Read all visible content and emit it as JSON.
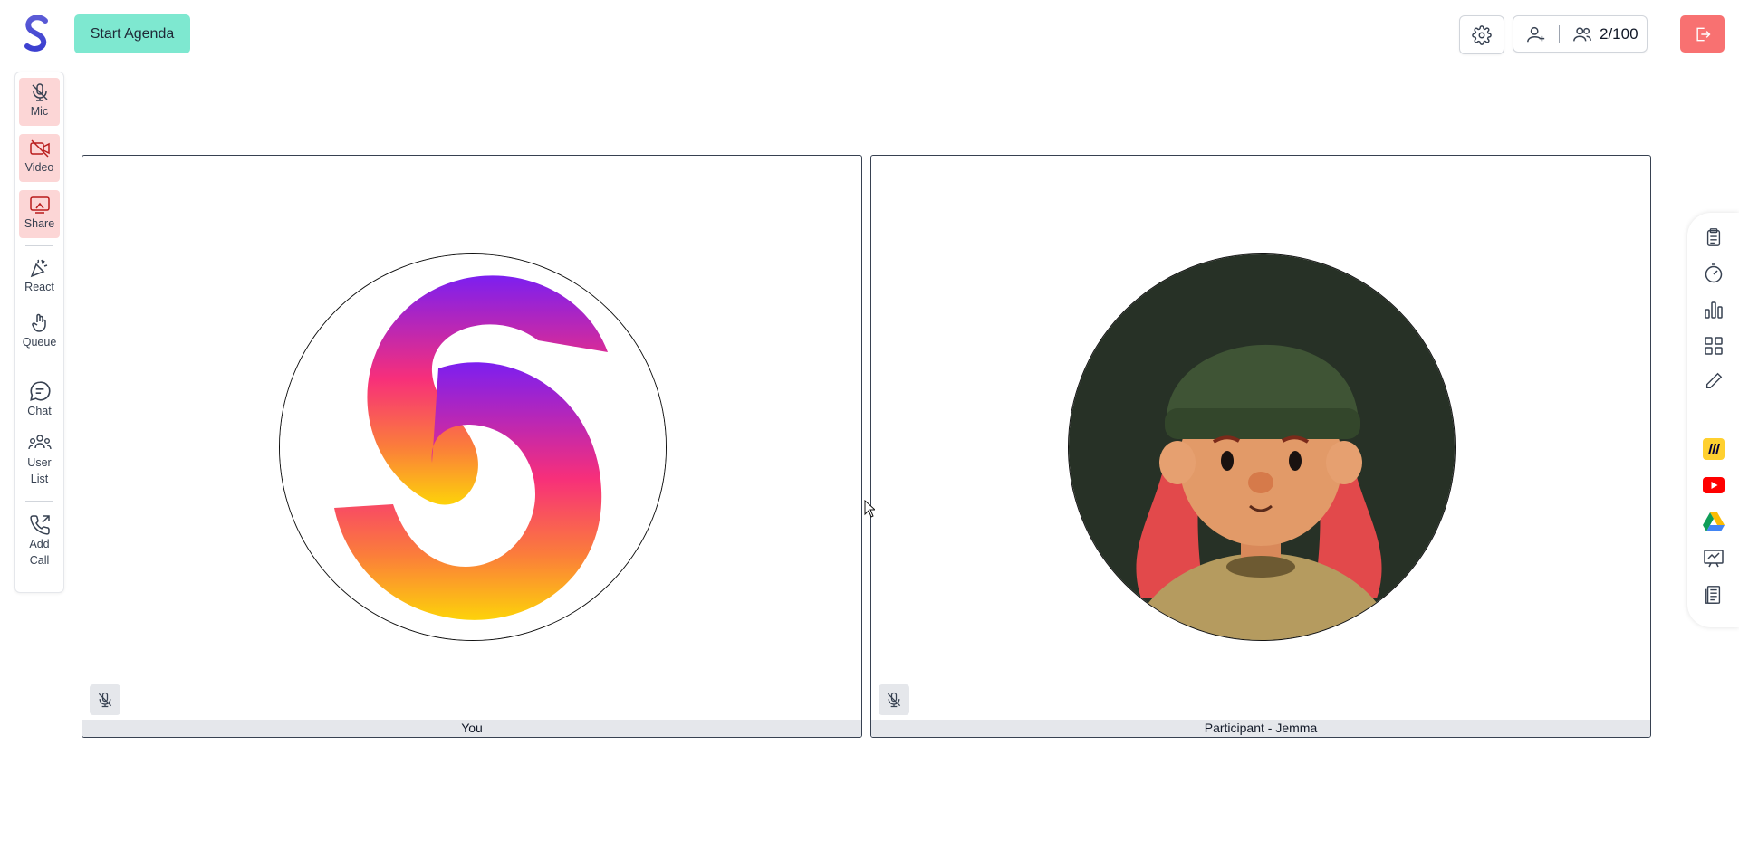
{
  "topbar": {
    "start_agenda_label": "Start Agenda",
    "participant_count": "2/100"
  },
  "left_sidebar": {
    "items": [
      {
        "label": "Mic",
        "icon": "mic-off-icon"
      },
      {
        "label": "Video",
        "icon": "video-off-icon"
      },
      {
        "label": "Share",
        "icon": "screen-share-icon"
      },
      {
        "label": "React",
        "icon": "party-popper-icon"
      },
      {
        "label": "Queue",
        "icon": "raise-hand-icon"
      },
      {
        "label": "Chat",
        "icon": "chat-bubble-icon"
      },
      {
        "label": "User List",
        "icon": "users-icon"
      },
      {
        "label": "Add Call",
        "icon": "phone-outgoing-icon"
      }
    ]
  },
  "tiles": [
    {
      "name": "You",
      "avatar": "logo-avatar"
    },
    {
      "name": "Participant - Jemma",
      "avatar": "character-avatar"
    }
  ],
  "right_sidebar": {
    "icons": [
      "clipboard-icon",
      "timer-icon",
      "bar-chart-icon",
      "grid-apps-icon",
      "pencil-icon",
      "miro-icon",
      "youtube-icon",
      "google-drive-icon",
      "whiteboard-icon",
      "document-icon"
    ]
  },
  "colors": {
    "accent": "#7ee8d0",
    "leave": "#f87171",
    "media_off": "#fcd6d6"
  }
}
